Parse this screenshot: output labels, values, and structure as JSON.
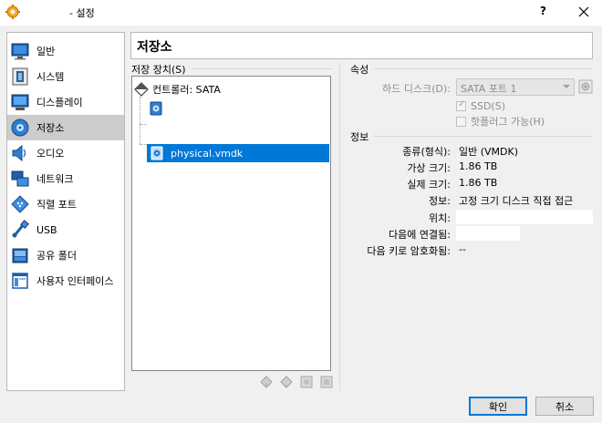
{
  "window": {
    "title": "- 설정",
    "help_label": "?"
  },
  "nav": {
    "items": [
      {
        "label": "일반",
        "icon": "general-monitor-icon"
      },
      {
        "label": "시스템",
        "icon": "system-chip-icon"
      },
      {
        "label": "디스플레이",
        "icon": "display-monitor-icon"
      },
      {
        "label": "저장소",
        "icon": "storage-disk-icon",
        "active": true
      },
      {
        "label": "오디오",
        "icon": "speaker-icon"
      },
      {
        "label": "네트워크",
        "icon": "network-icon"
      },
      {
        "label": "직렬 포트",
        "icon": "serial-port-icon"
      },
      {
        "label": "USB",
        "icon": "usb-icon"
      },
      {
        "label": "공유 폴더",
        "icon": "shared-folder-icon"
      },
      {
        "label": "사용자 인터페이스",
        "icon": "user-interface-icon"
      }
    ]
  },
  "page_title": "저장소",
  "storage": {
    "header": "저장 장치(S)",
    "controller": "컨트롤러: SATA",
    "attachments": [
      {
        "label": "",
        "icon": "optical-disk-icon"
      },
      {
        "label": "physical.vmdk",
        "icon": "hard-disk-icon",
        "selected": true
      }
    ]
  },
  "attributes": {
    "header": "속성",
    "hard_disk_label": "하드 디스크(D):",
    "hard_disk_value": "SATA 포트 1",
    "ssd_label": "SSD(S)",
    "hotplug_label": "핫플러그 가능(H)"
  },
  "info": {
    "header": "정보",
    "rows": [
      {
        "label": "종류(형식):",
        "value": "일반 (VMDK)"
      },
      {
        "label": "가상 크기:",
        "value": "1.86 TB"
      },
      {
        "label": "실제 크기:",
        "value": "1.86 TB"
      },
      {
        "label": "정보:",
        "value": "고정 크기 디스크 직접 접근"
      },
      {
        "label": "위치:",
        "value": ""
      },
      {
        "label": "다음에 연결됨:",
        "value": ""
      },
      {
        "label": "다음 키로 암호화됨:",
        "value": "--"
      }
    ]
  },
  "buttons": {
    "ok": "확인",
    "cancel": "취소"
  },
  "colors": {
    "selection": "#0078d7",
    "nav_active": "#cccccc",
    "window_bg": "#f0f0f0"
  }
}
